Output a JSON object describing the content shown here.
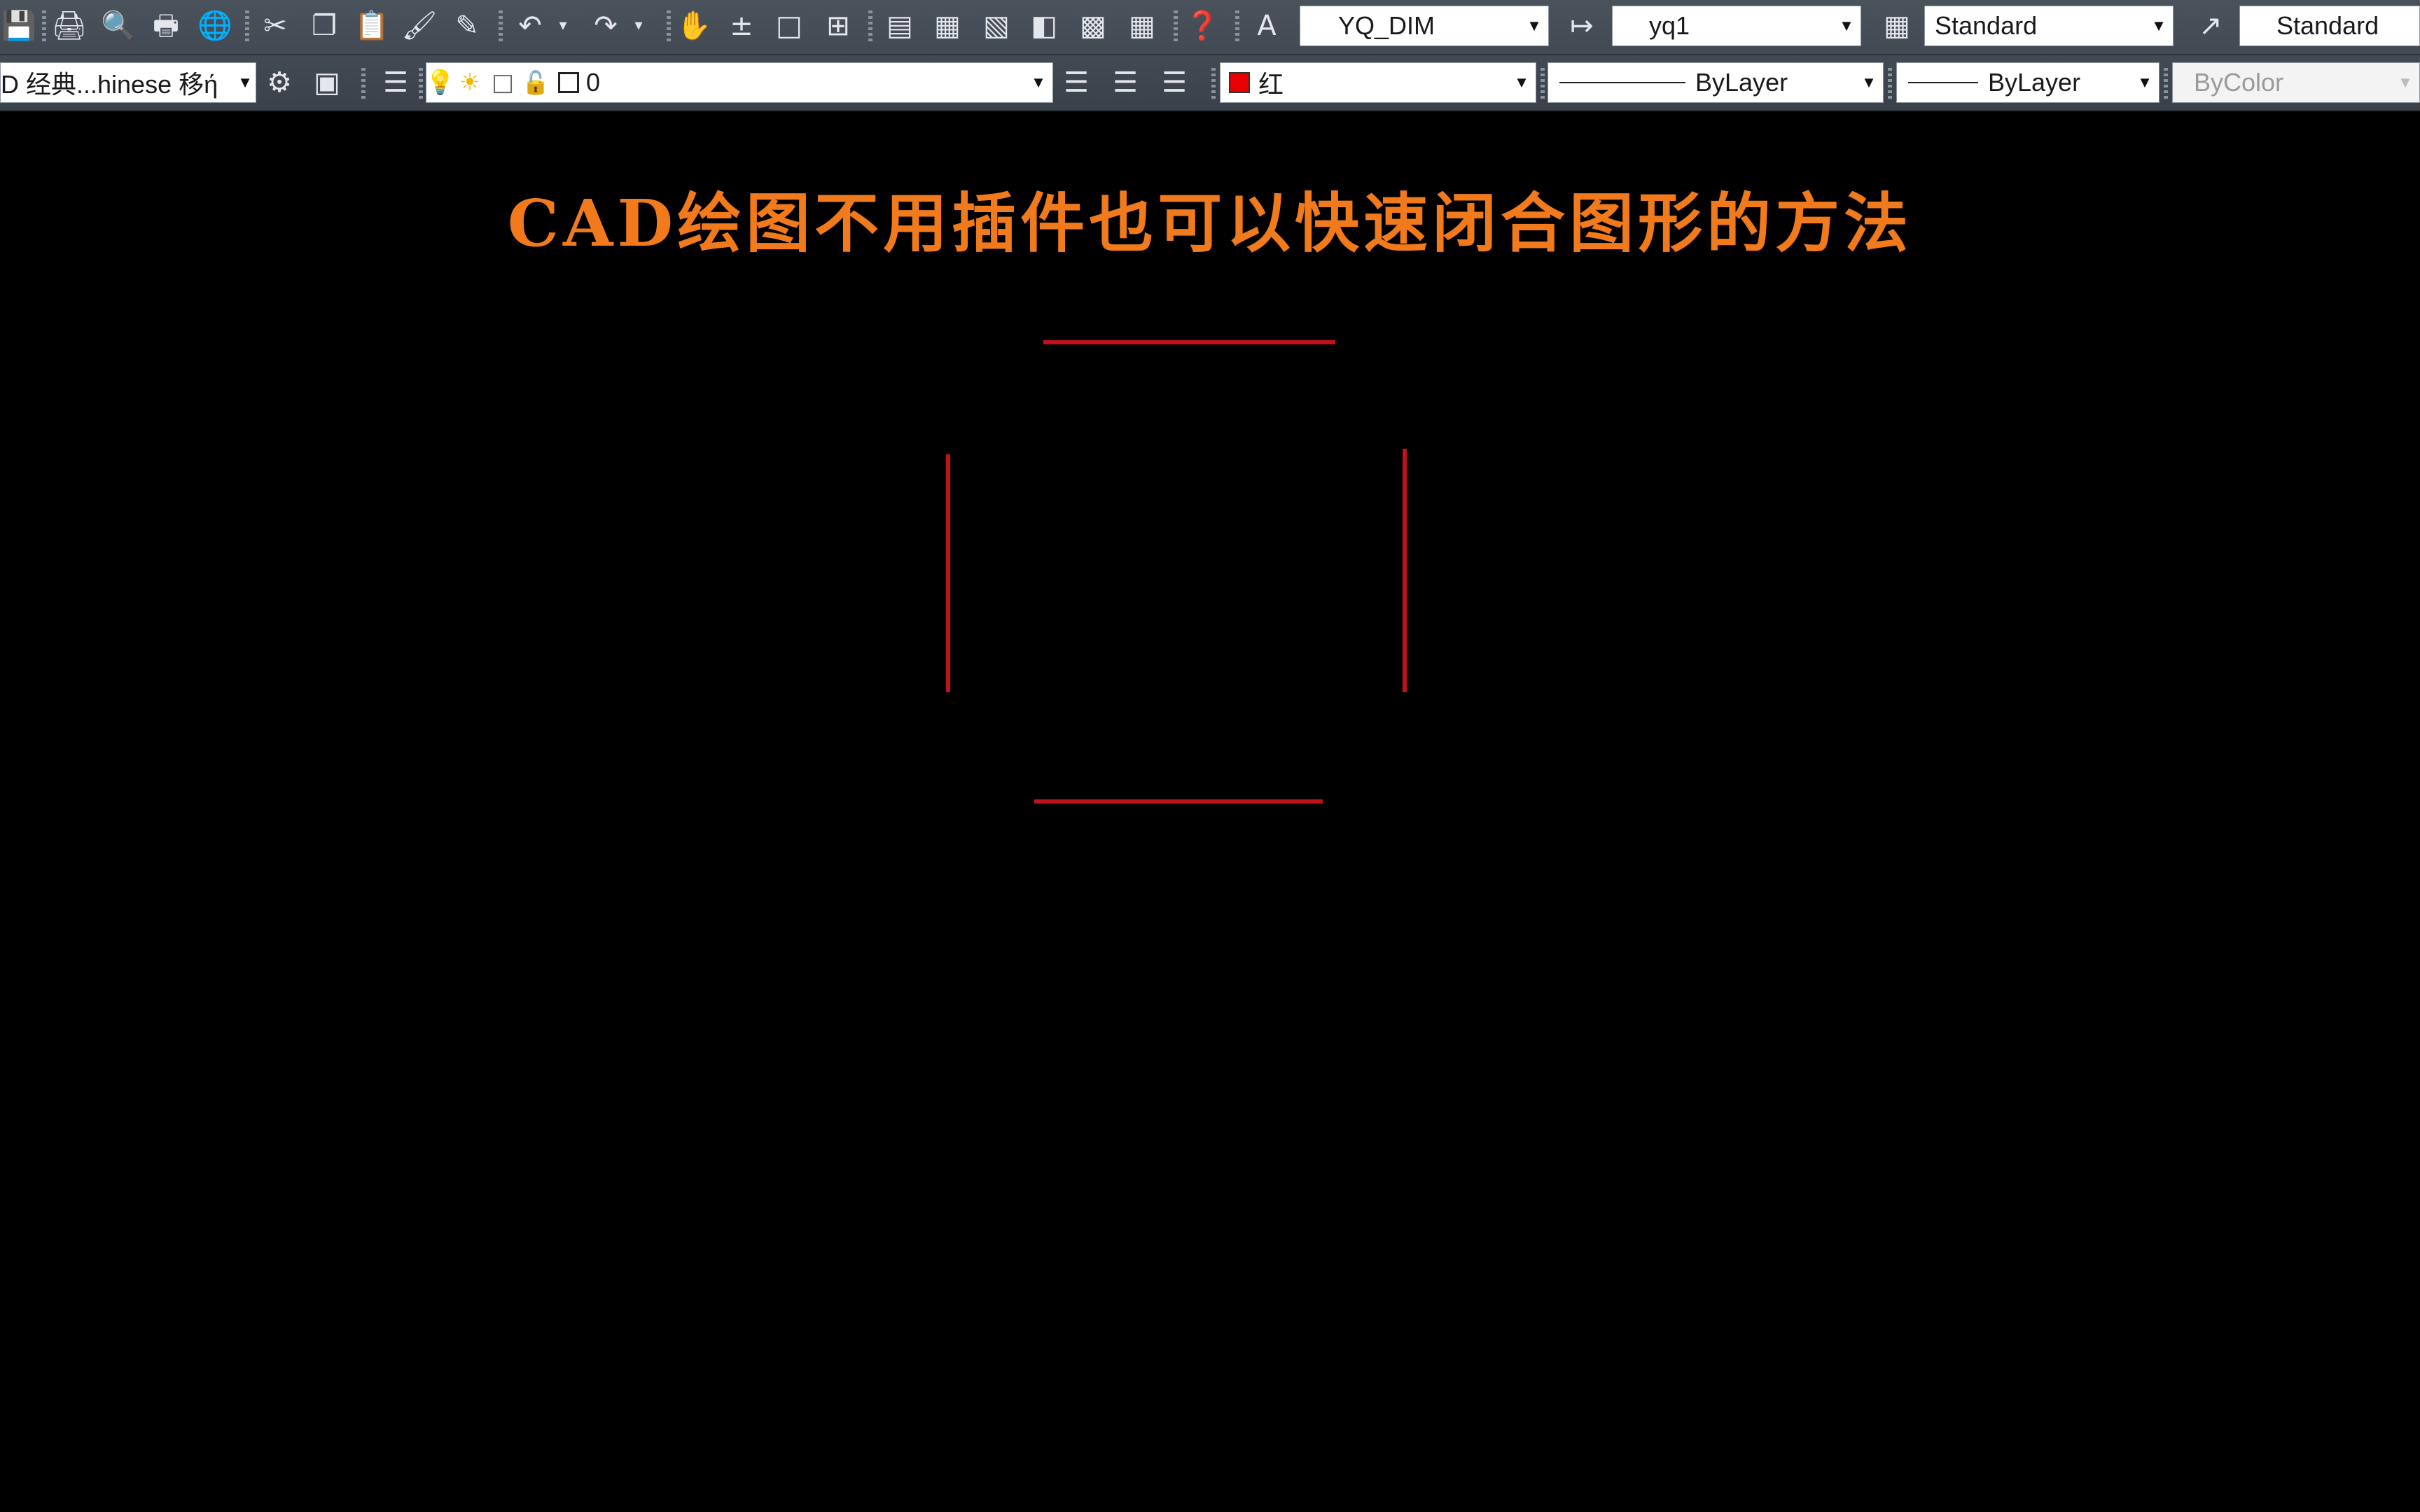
{
  "toolbar_row1": {
    "icons": [
      "save-icon",
      "print-icon",
      "print-preview-icon",
      "plot-icon",
      "publish-icon",
      "cut-icon",
      "copy-icon",
      "paste-icon",
      "match-properties-icon",
      "block-editor-icon",
      "undo-icon",
      "undo-dropdown-icon",
      "redo-icon",
      "redo-dropdown-icon",
      "pan-icon",
      "zoom-realtime-icon",
      "zoom-window-icon",
      "zoom-previous-icon",
      "properties-icon",
      "design-center-icon",
      "tool-palettes-icon",
      "sheet-set-icon",
      "markup-icon",
      "quickcalc-icon",
      "help-icon",
      "text-style-icon",
      "dim-style-icon",
      "table-style-icon",
      "multileader-style-icon"
    ],
    "text_style_value": "YQ_DIM",
    "dim_style_value": "yq1",
    "table_style_value": "Standard",
    "multileader_style_value": "Standard"
  },
  "toolbar_row2": {
    "workspace_value": "D 经典...hinese 移",
    "workspace_cut_glyph": "ή",
    "layer_icons": [
      "workspace-settings-icon",
      "customize-icon",
      "layer-properties-icon",
      "light-bulb-icon",
      "sun-icon",
      "freeze-viewport-icon",
      "lock-icon"
    ],
    "layer_value": "0",
    "layer_tool_icons": [
      "make-current-icon",
      "layer-previous-icon",
      "layer-states-icon"
    ],
    "color_value": "红",
    "color_hex": "#e60000",
    "linetype_value": "ByLayer",
    "lineweight_value": "ByLayer",
    "plotstyle_value": "ByColor"
  },
  "drawing": {
    "title": "CAD绘图不用插件也可以快速闭合图形的方法",
    "title_color": "#f07a1c",
    "line_color": "#c0121b",
    "line_count": 4
  }
}
